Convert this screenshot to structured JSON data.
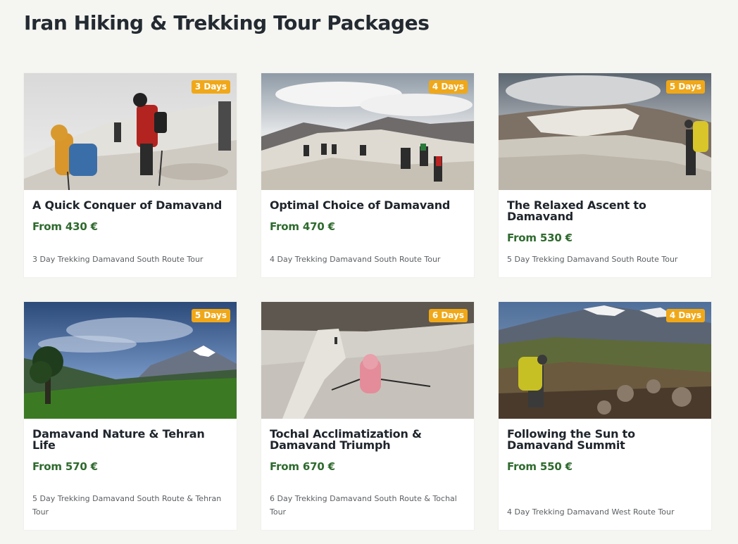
{
  "page": {
    "title": "Iran Hiking & Trekking Tour Packages"
  },
  "colors": {
    "background": "#f5f5f1",
    "badge": "#f0a818",
    "price": "#2e6a2e"
  },
  "cards": [
    {
      "duration": "3 Days",
      "title": "A Quick Conquer of Damavand",
      "price": "From 430 €",
      "description": "3 Day Trekking Damavand South Route Tour"
    },
    {
      "duration": "4 Days",
      "title": "Optimal Choice of Damavand",
      "price": "From 470 €",
      "description": "4 Day Trekking Damavand South Route Tour"
    },
    {
      "duration": "5 Days",
      "title": "The Relaxed Ascent to Damavand",
      "price": "From 530 €",
      "description": "5 Day Trekking Damavand South Route Tour"
    },
    {
      "duration": "5 Days",
      "title": "Damavand Nature & Tehran Life",
      "price": "From 570 €",
      "description": "5 Day Trekking Damavand South Route & Tehran Tour"
    },
    {
      "duration": "6 Days",
      "title": "Tochal Acclimatization & Damavand Triumph",
      "price": "From 670 €",
      "description": "6 Day Trekking Damavand South Route & Tochal Tour"
    },
    {
      "duration": "4 Days",
      "title": "Following the Sun to Damavand Summit",
      "price": "From 550 €",
      "description": "4 Day Trekking Damavand West Route Tour"
    }
  ]
}
